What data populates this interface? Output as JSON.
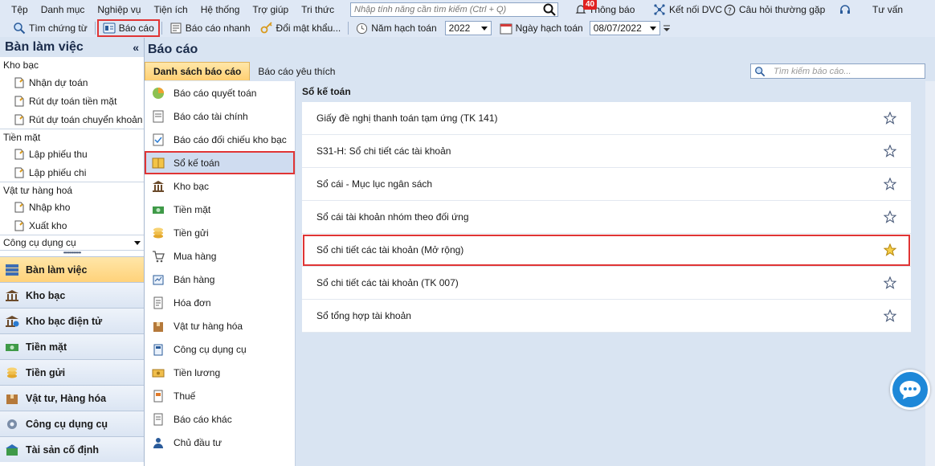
{
  "menubar": {
    "items": [
      "Tệp",
      "Danh mục",
      "Nghiệp vụ",
      "Tiện ích",
      "Hệ thống",
      "Trợ giúp",
      "Tri thức"
    ],
    "search_placeholder": "Nhập tính năng cần tìm kiếm (Ctrl + Q)",
    "notification_count": "40",
    "notification_label": "Thông báo",
    "connect_label": "Kết nối DVC",
    "faq_label": "Câu hỏi thường gặp",
    "support_label": "Tư vấn"
  },
  "toolbar": {
    "find_voucher": "Tìm chứng từ",
    "report": "Báo cáo",
    "quick_report": "Báo cáo nhanh",
    "change_password": "Đổi mật khẩu...",
    "fiscal_year_label": "Năm hạch toán",
    "fiscal_year_value": "2022",
    "posting_date_label": "Ngày hạch toán",
    "posting_date_value": "08/07/2022"
  },
  "sidebar": {
    "title": "Bàn làm việc",
    "groups": [
      {
        "label": "Kho bạc",
        "items": [
          "Nhận dự toán",
          "Rút dự toán tiền mặt",
          "Rút dự toán chuyển khoản"
        ]
      },
      {
        "label": "Tiền mặt",
        "items": [
          "Lập phiếu thu",
          "Lập phiếu chi"
        ]
      },
      {
        "label": "Vật tư hàng hoá",
        "items": [
          "Nhập kho",
          "Xuất kho"
        ]
      }
    ],
    "combo_value": "Công cụ dụng cụ",
    "nav": [
      "Bàn làm việc",
      "Kho bạc",
      "Kho bạc điện tử",
      "Tiền mặt",
      "Tiền gửi",
      "Vật tư, Hàng hóa",
      "Công cụ dụng cụ",
      "Tài sản cố định"
    ]
  },
  "main": {
    "title": "Báo cáo",
    "tabs": [
      "Danh sách báo cáo",
      "Báo cáo yêu thích"
    ],
    "search_placeholder": "Tìm kiếm báo cáo...",
    "categories": [
      "Báo cáo quyết toán",
      "Báo cáo tài chính",
      "Báo cáo đối chiếu kho bạc",
      "Sổ kế toán",
      "Kho bạc",
      "Tiền mặt",
      "Tiền gửi",
      "Mua hàng",
      "Bán hàng",
      "Hóa đơn",
      "Vật tư hàng hóa",
      "Công cụ dụng cụ",
      "Tiền lương",
      "Thuế",
      "Báo cáo khác",
      "Chủ đầu tư"
    ],
    "section_title": "Sổ kế toán",
    "reports": [
      "Giấy đề nghị thanh toán tạm ứng (TK 141)",
      "S31-H: Sổ chi tiết các tài khoản",
      "Sổ cái - Mục lục ngân sách",
      "Sổ cái tài khoản nhóm theo đối ứng",
      "Sổ chi tiết các tài khoản (Mở rộng)",
      "Sổ chi tiết các tài khoản (TK 007)",
      "Sổ tổng hợp tài khoản"
    ]
  },
  "colors": {
    "accent": "#ffd27a",
    "highlight_border": "#e03535",
    "chat": "#1e88d8"
  }
}
